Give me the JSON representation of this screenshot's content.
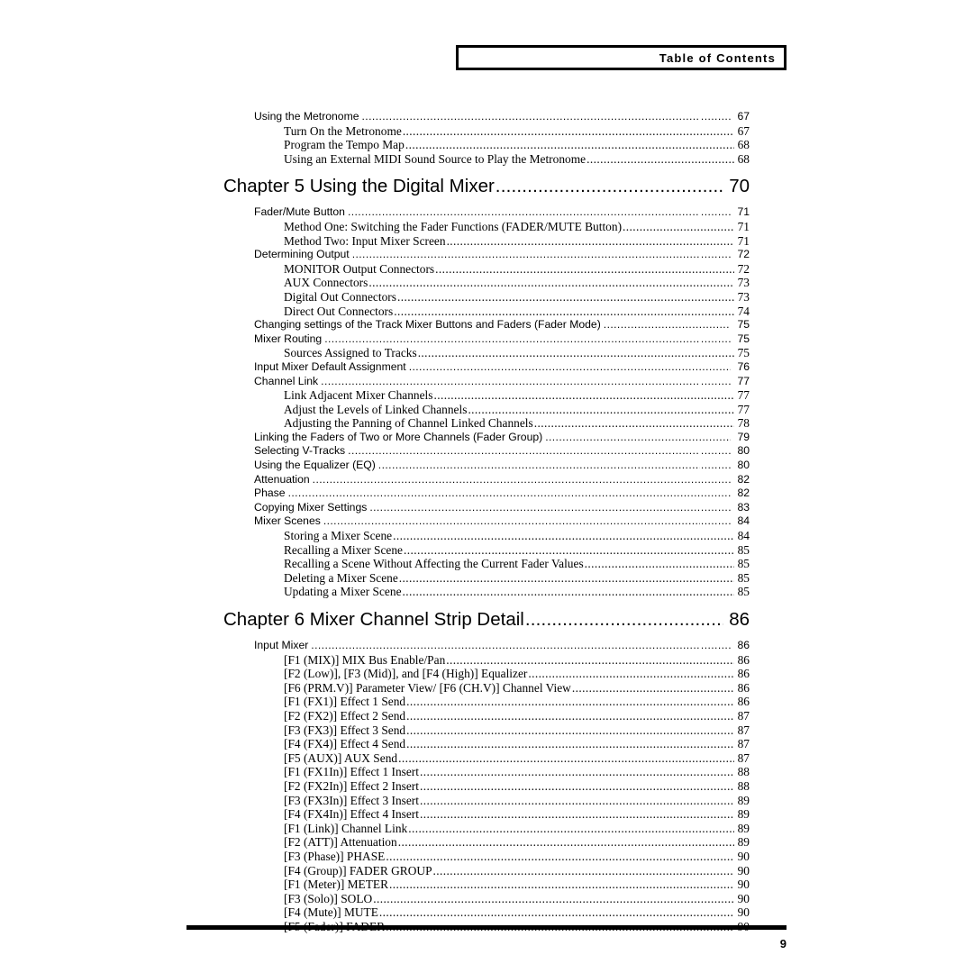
{
  "header": {
    "title": "Table of Contents"
  },
  "footer": {
    "page_number": "9"
  },
  "toc": {
    "entries": [
      {
        "level": 1,
        "label": "Using the Metronome",
        "page": "67"
      },
      {
        "level": 2,
        "label": "Turn On the Metronome",
        "page": "67"
      },
      {
        "level": 2,
        "label": "Program the Tempo Map",
        "page": "68"
      },
      {
        "level": 2,
        "label": "Using an External MIDI Sound Source to Play the Metronome",
        "page": "68"
      },
      {
        "level": 0,
        "label": "Chapter 5 Using the Digital Mixer",
        "page": "70"
      },
      {
        "level": 1,
        "label": "Fader/Mute Button",
        "page": "71"
      },
      {
        "level": 2,
        "label": "Method One: Switching the Fader Functions (FADER/MUTE Button)",
        "page": "71"
      },
      {
        "level": 2,
        "label": "Method Two: Input Mixer Screen",
        "page": "71"
      },
      {
        "level": 1,
        "label": "Determining Output",
        "page": "72"
      },
      {
        "level": 2,
        "label": "MONITOR Output Connectors",
        "page": "72"
      },
      {
        "level": 2,
        "label": "AUX Connectors",
        "page": "73"
      },
      {
        "level": 2,
        "label": "Digital Out Connectors",
        "page": "73"
      },
      {
        "level": 2,
        "label": "Direct Out Connectors",
        "page": "74"
      },
      {
        "level": 1,
        "label": "Changing settings of the Track Mixer Buttons and Faders (Fader Mode)",
        "page": "75",
        "tight": true
      },
      {
        "level": 1,
        "label": "Mixer Routing",
        "page": "75"
      },
      {
        "level": 2,
        "label": "Sources Assigned to Tracks",
        "page": "75"
      },
      {
        "level": 1,
        "label": "Input Mixer Default Assignment",
        "page": "76",
        "tight": true
      },
      {
        "level": 1,
        "label": "Channel Link",
        "page": "77"
      },
      {
        "level": 2,
        "label": "Link Adjacent Mixer Channels",
        "page": "77"
      },
      {
        "level": 2,
        "label": "Adjust the Levels of Linked Channels",
        "page": "77"
      },
      {
        "level": 2,
        "label": "Adjusting the Panning of Channel Linked Channels",
        "page": "78"
      },
      {
        "level": 1,
        "label": "Linking the Faders of Two or More Channels (Fader Group)",
        "page": "79",
        "tight": true
      },
      {
        "level": 1,
        "label": "Selecting V-Tracks",
        "page": "80"
      },
      {
        "level": 1,
        "label": "Using the Equalizer (EQ)",
        "page": "80"
      },
      {
        "level": 1,
        "label": "Attenuation",
        "page": "82"
      },
      {
        "level": 1,
        "label": "Phase",
        "page": "82",
        "tight": true
      },
      {
        "level": 1,
        "label": "Copying Mixer Settings",
        "page": "83"
      },
      {
        "level": 1,
        "label": "Mixer Scenes",
        "page": "84"
      },
      {
        "level": 2,
        "label": "Storing a Mixer Scene",
        "page": "84"
      },
      {
        "level": 2,
        "label": "Recalling a Mixer Scene",
        "page": "85"
      },
      {
        "level": 2,
        "label": "Recalling a Scene Without Affecting the Current Fader Values",
        "page": "85"
      },
      {
        "level": 2,
        "label": "Deleting a Mixer Scene",
        "page": "85"
      },
      {
        "level": 2,
        "label": "Updating a Mixer Scene",
        "page": "85"
      },
      {
        "level": 0,
        "label": "Chapter 6 Mixer Channel Strip Detail",
        "page": "86"
      },
      {
        "level": 1,
        "label": "Input Mixer",
        "page": "86"
      },
      {
        "level": 2,
        "label": "[F1 (MIX)] MIX Bus Enable/Pan",
        "page": "86"
      },
      {
        "level": 2,
        "label": "[F2 (Low)], [F3 (Mid)], and [F4 (High)] Equalizer",
        "page": "86"
      },
      {
        "level": 2,
        "label": "[F6 (PRM.V)] Parameter View/ [F6 (CH.V)] Channel View",
        "page": "86"
      },
      {
        "level": 2,
        "label": "[F1 (FX1)] Effect 1 Send",
        "page": "86"
      },
      {
        "level": 2,
        "label": "[F2 (FX2)] Effect 2 Send",
        "page": "87"
      },
      {
        "level": 2,
        "label": "[F3 (FX3)] Effect 3 Send",
        "page": "87"
      },
      {
        "level": 2,
        "label": "[F4 (FX4)] Effect 4 Send",
        "page": "87"
      },
      {
        "level": 2,
        "label": "[F5 (AUX)] AUX Send",
        "page": "87"
      },
      {
        "level": 2,
        "label": "[F1 (FX1In)] Effect 1 Insert",
        "page": "88"
      },
      {
        "level": 2,
        "label": "[F2 (FX2In)] Effect 2 Insert",
        "page": "88"
      },
      {
        "level": 2,
        "label": "[F3 (FX3In)] Effect 3 Insert",
        "page": "89"
      },
      {
        "level": 2,
        "label": "[F4 (FX4In)] Effect 4 Insert",
        "page": "89"
      },
      {
        "level": 2,
        "label": "[F1 (Link)] Channel Link",
        "page": "89"
      },
      {
        "level": 2,
        "label": "[F2 (ATT)] Attenuation",
        "page": "89"
      },
      {
        "level": 2,
        "label": "[F3 (Phase)] PHASE",
        "page": "90"
      },
      {
        "level": 2,
        "label": "[F4 (Group)] FADER GROUP",
        "page": "90"
      },
      {
        "level": 2,
        "label": "[F1 (Meter)] METER",
        "page": "90"
      },
      {
        "level": 2,
        "label": "[F3 (Solo)] SOLO",
        "page": "90"
      },
      {
        "level": 2,
        "label": "[F4 (Mute)] MUTE",
        "page": "90"
      },
      {
        "level": 2,
        "label": "[F5 (Fader)] FADER",
        "page": "90"
      }
    ]
  }
}
